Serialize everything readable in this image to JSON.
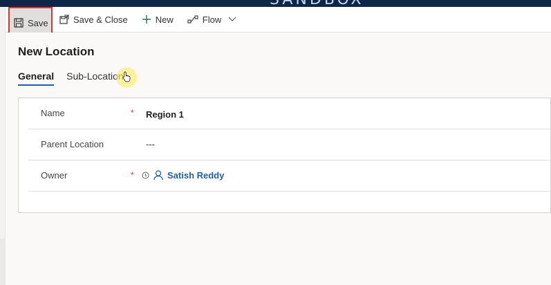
{
  "topbar": {
    "brand": "SANDBOX"
  },
  "commandbar": {
    "save_label": "Save",
    "save_close_label": "Save & Close",
    "new_label": "New",
    "flow_label": "Flow"
  },
  "form": {
    "title": "New Location",
    "tabs": [
      {
        "label": "General",
        "active": true
      },
      {
        "label": "Sub-Locations",
        "active": false
      }
    ],
    "fields": {
      "name": {
        "label": "Name",
        "required": "*",
        "value": "Region 1"
      },
      "parent": {
        "label": "Parent Location",
        "value": "---"
      },
      "owner": {
        "label": "Owner",
        "required": "*",
        "value": "Satish Reddy"
      }
    }
  },
  "colors": {
    "accent": "#1f5fa8",
    "required": "#d13438",
    "highlight_border": "#e0312a",
    "topbar": "#0e2749"
  }
}
